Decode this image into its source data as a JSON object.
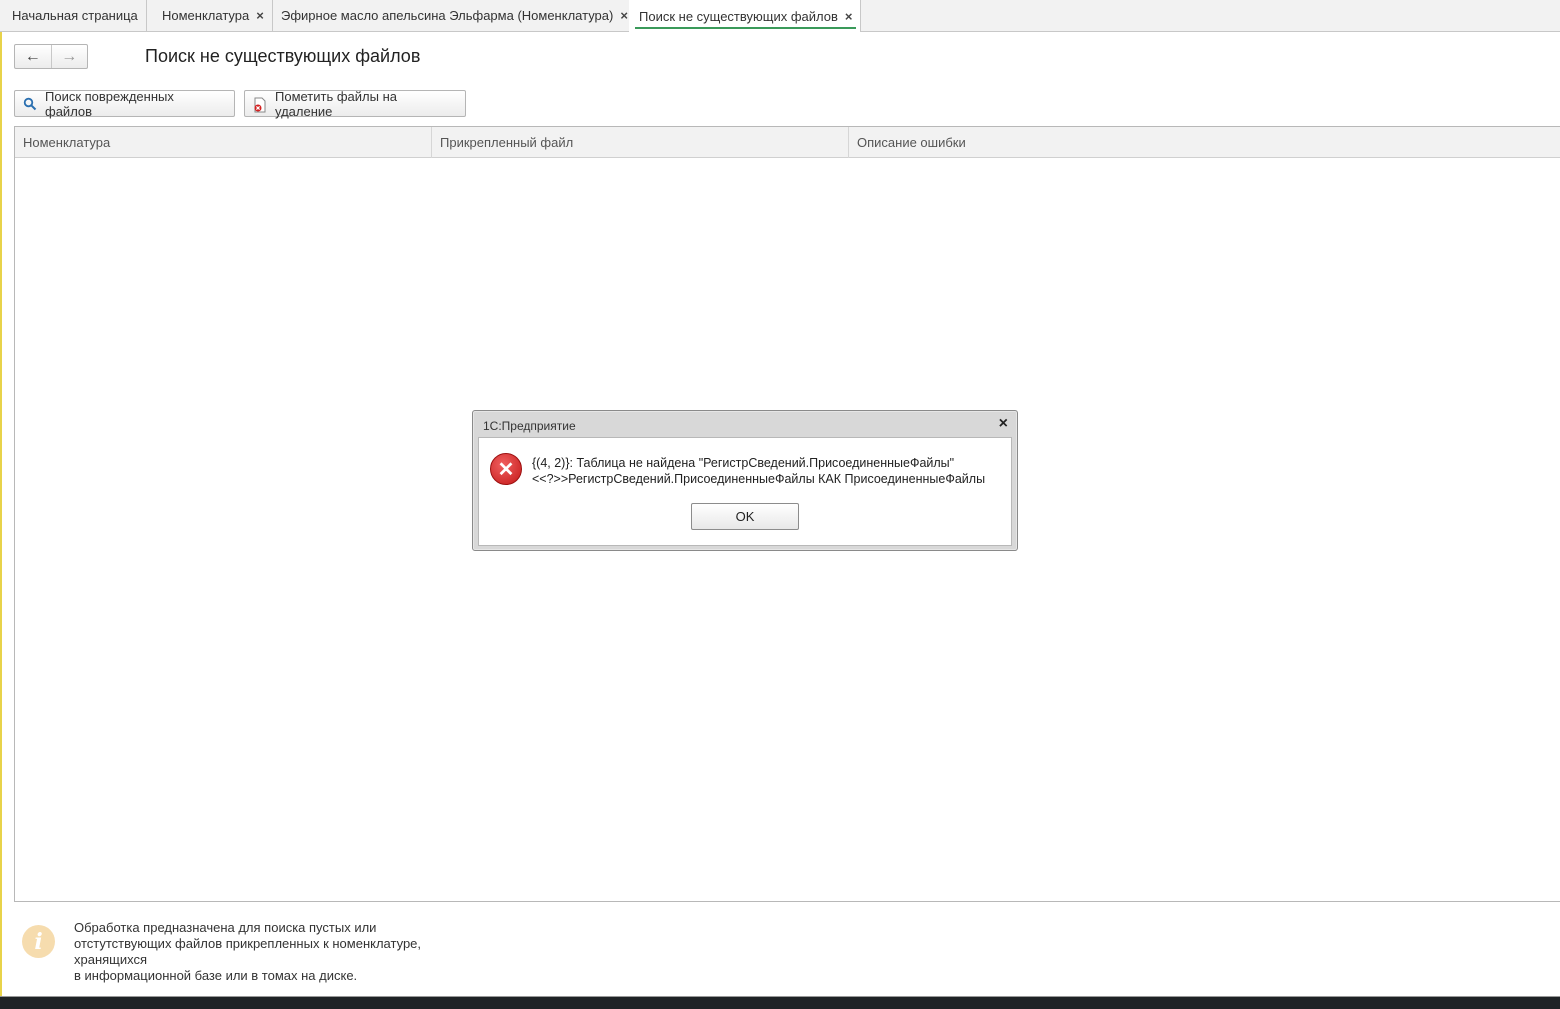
{
  "tabs": [
    {
      "label": "Начальная страница",
      "closable": false,
      "active": false
    },
    {
      "label": "Номенклатура",
      "closable": true,
      "active": false
    },
    {
      "label": "Эфирное масло апельсина Эльфарма (Номенклатура)",
      "closable": true,
      "active": false
    },
    {
      "label": "Поиск не существующих файлов",
      "closable": true,
      "active": true
    }
  ],
  "tab_close_glyph": "×",
  "nav": {
    "back_glyph": "←",
    "forward_glyph": "→"
  },
  "page_title": "Поиск не существующих файлов",
  "toolbar": {
    "search_damaged_label": "Поиск поврежденных файлов",
    "mark_delete_label": "Пометить файлы на удаление"
  },
  "table": {
    "columns": [
      "Номенклатура",
      "Прикрепленный файл",
      "Описание ошибки"
    ],
    "rows": []
  },
  "info": {
    "icon_glyph": "i",
    "lines": [
      "Обработка предназначена для поиска пустых или",
      "отстутствующих файлов прикрепленных к номенклатуре,",
      "хранящихся",
      "в информационной базе или в томах на диске."
    ]
  },
  "dialog": {
    "title": "1С:Предприятие",
    "close_glyph": "×",
    "error_glyph": "✕",
    "message_lines": [
      "{(4, 2)}: Таблица не найдена \"РегистрСведений.ПрисоединенныеФайлы\"",
      "<<?>>РегистрСведений.ПрисоединенныеФайлы КАК ПрисоединенныеФайлы"
    ],
    "ok_label": "OK"
  },
  "colors": {
    "accent_green": "#3a9a5a",
    "error_red": "#c41818",
    "info_orange": "#f6dcae",
    "left_strip": "#e8d34a"
  }
}
